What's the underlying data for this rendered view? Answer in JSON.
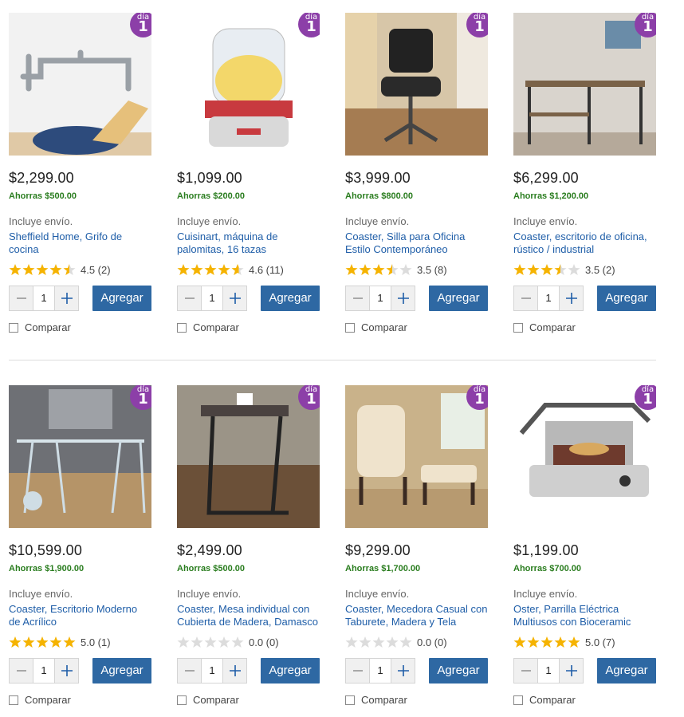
{
  "badge": {
    "word": "día",
    "number": "1"
  },
  "labels": {
    "shipping": "Incluye envío.",
    "add": "Agregar",
    "compare": "Comparar"
  },
  "colors": {
    "badge": "#8c3fa8",
    "save": "#2a7d1f",
    "link": "#1f5ea8",
    "button": "#2e68a3",
    "star": "#f5b301"
  },
  "products": [
    {
      "price": "$2,299.00",
      "savings": "Ahorras $500.00",
      "name": "Sheffield Home, Grifo de cocina",
      "rating": 4.5,
      "rating_text": "4.5 (2)",
      "qty": "1",
      "image": "pot-filler-faucet"
    },
    {
      "price": "$1,099.00",
      "savings": "Ahorras $200.00",
      "name": "Cuisinart, máquina de palomitas, 16 tazas",
      "rating": 4.6,
      "rating_text": "4.6 (11)",
      "qty": "1",
      "image": "popcorn-maker"
    },
    {
      "price": "$3,999.00",
      "savings": "Ahorras $800.00",
      "name": "Coaster, Silla para Oficina Estilo Contemporáneo",
      "rating": 3.5,
      "rating_text": "3.5 (8)",
      "qty": "1",
      "image": "office-chair"
    },
    {
      "price": "$6,299.00",
      "savings": "Ahorras $1,200.00",
      "name": "Coaster, escritorio de oficina, rústico / industrial",
      "rating": 3.5,
      "rating_text": "3.5 (2)",
      "qty": "1",
      "image": "rustic-desk"
    },
    {
      "price": "$10,599.00",
      "savings": "Ahorras $1,900.00",
      "name": "Coaster, Escritorio Moderno de Acrílico",
      "rating": 5.0,
      "rating_text": "5.0 (1)",
      "qty": "1",
      "image": "acrylic-desk"
    },
    {
      "price": "$2,499.00",
      "savings": "Ahorras $500.00",
      "name": "Coaster, Mesa individual con Cubierta de Madera, Damasco",
      "rating": 0,
      "rating_text": "0.0 (0)",
      "qty": "1",
      "image": "side-table"
    },
    {
      "price": "$9,299.00",
      "savings": "Ahorras $1,700.00",
      "name": "Coaster, Mecedora Casual con Taburete, Madera y Tela",
      "rating": 0,
      "rating_text": "0.0 (0)",
      "qty": "1",
      "image": "glider-rocker"
    },
    {
      "price": "$1,199.00",
      "savings": "Ahorras $700.00",
      "name": "Oster, Parrilla Eléctrica Multiusos con Bioceramic",
      "rating": 5.0,
      "rating_text": "5.0 (7)",
      "qty": "1",
      "image": "electric-grill"
    }
  ]
}
